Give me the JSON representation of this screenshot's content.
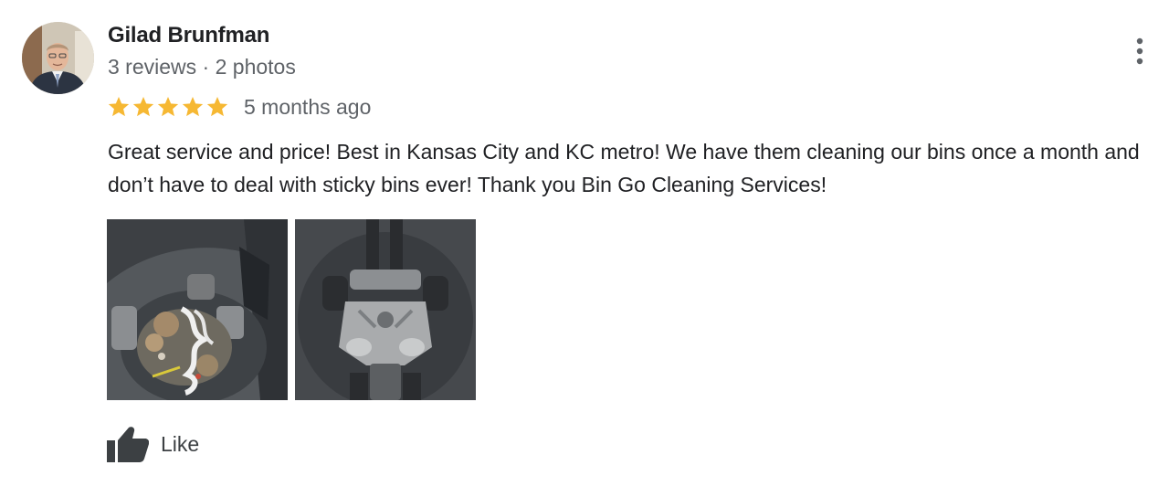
{
  "reviewer": {
    "name": "Gilad Brunfman",
    "reviews": "3 reviews",
    "separator": "·",
    "photos": "2 photos",
    "avatar_icon": "user-avatar-photo"
  },
  "rating": {
    "stars": 5,
    "max_stars": 5,
    "star_color": "#f6b833",
    "date": "5 months ago"
  },
  "review_text": "Great service and price! Best in Kansas City and KC metro! We have them cleaning our bins once a month and don’t have to deal with sticky bins ever! Thank you Bin Go Cleaning Services!",
  "photos": [
    {
      "description_icon": "dirty-bin-photo"
    },
    {
      "description_icon": "clean-bin-photo"
    }
  ],
  "actions": {
    "like_label": "Like",
    "like_icon": "thumbs-up-icon",
    "more_icon": "more-vert-icon"
  },
  "colors": {
    "secondary_text": "#5f6368",
    "primary_text": "#202124",
    "icon": "#3c4043"
  }
}
